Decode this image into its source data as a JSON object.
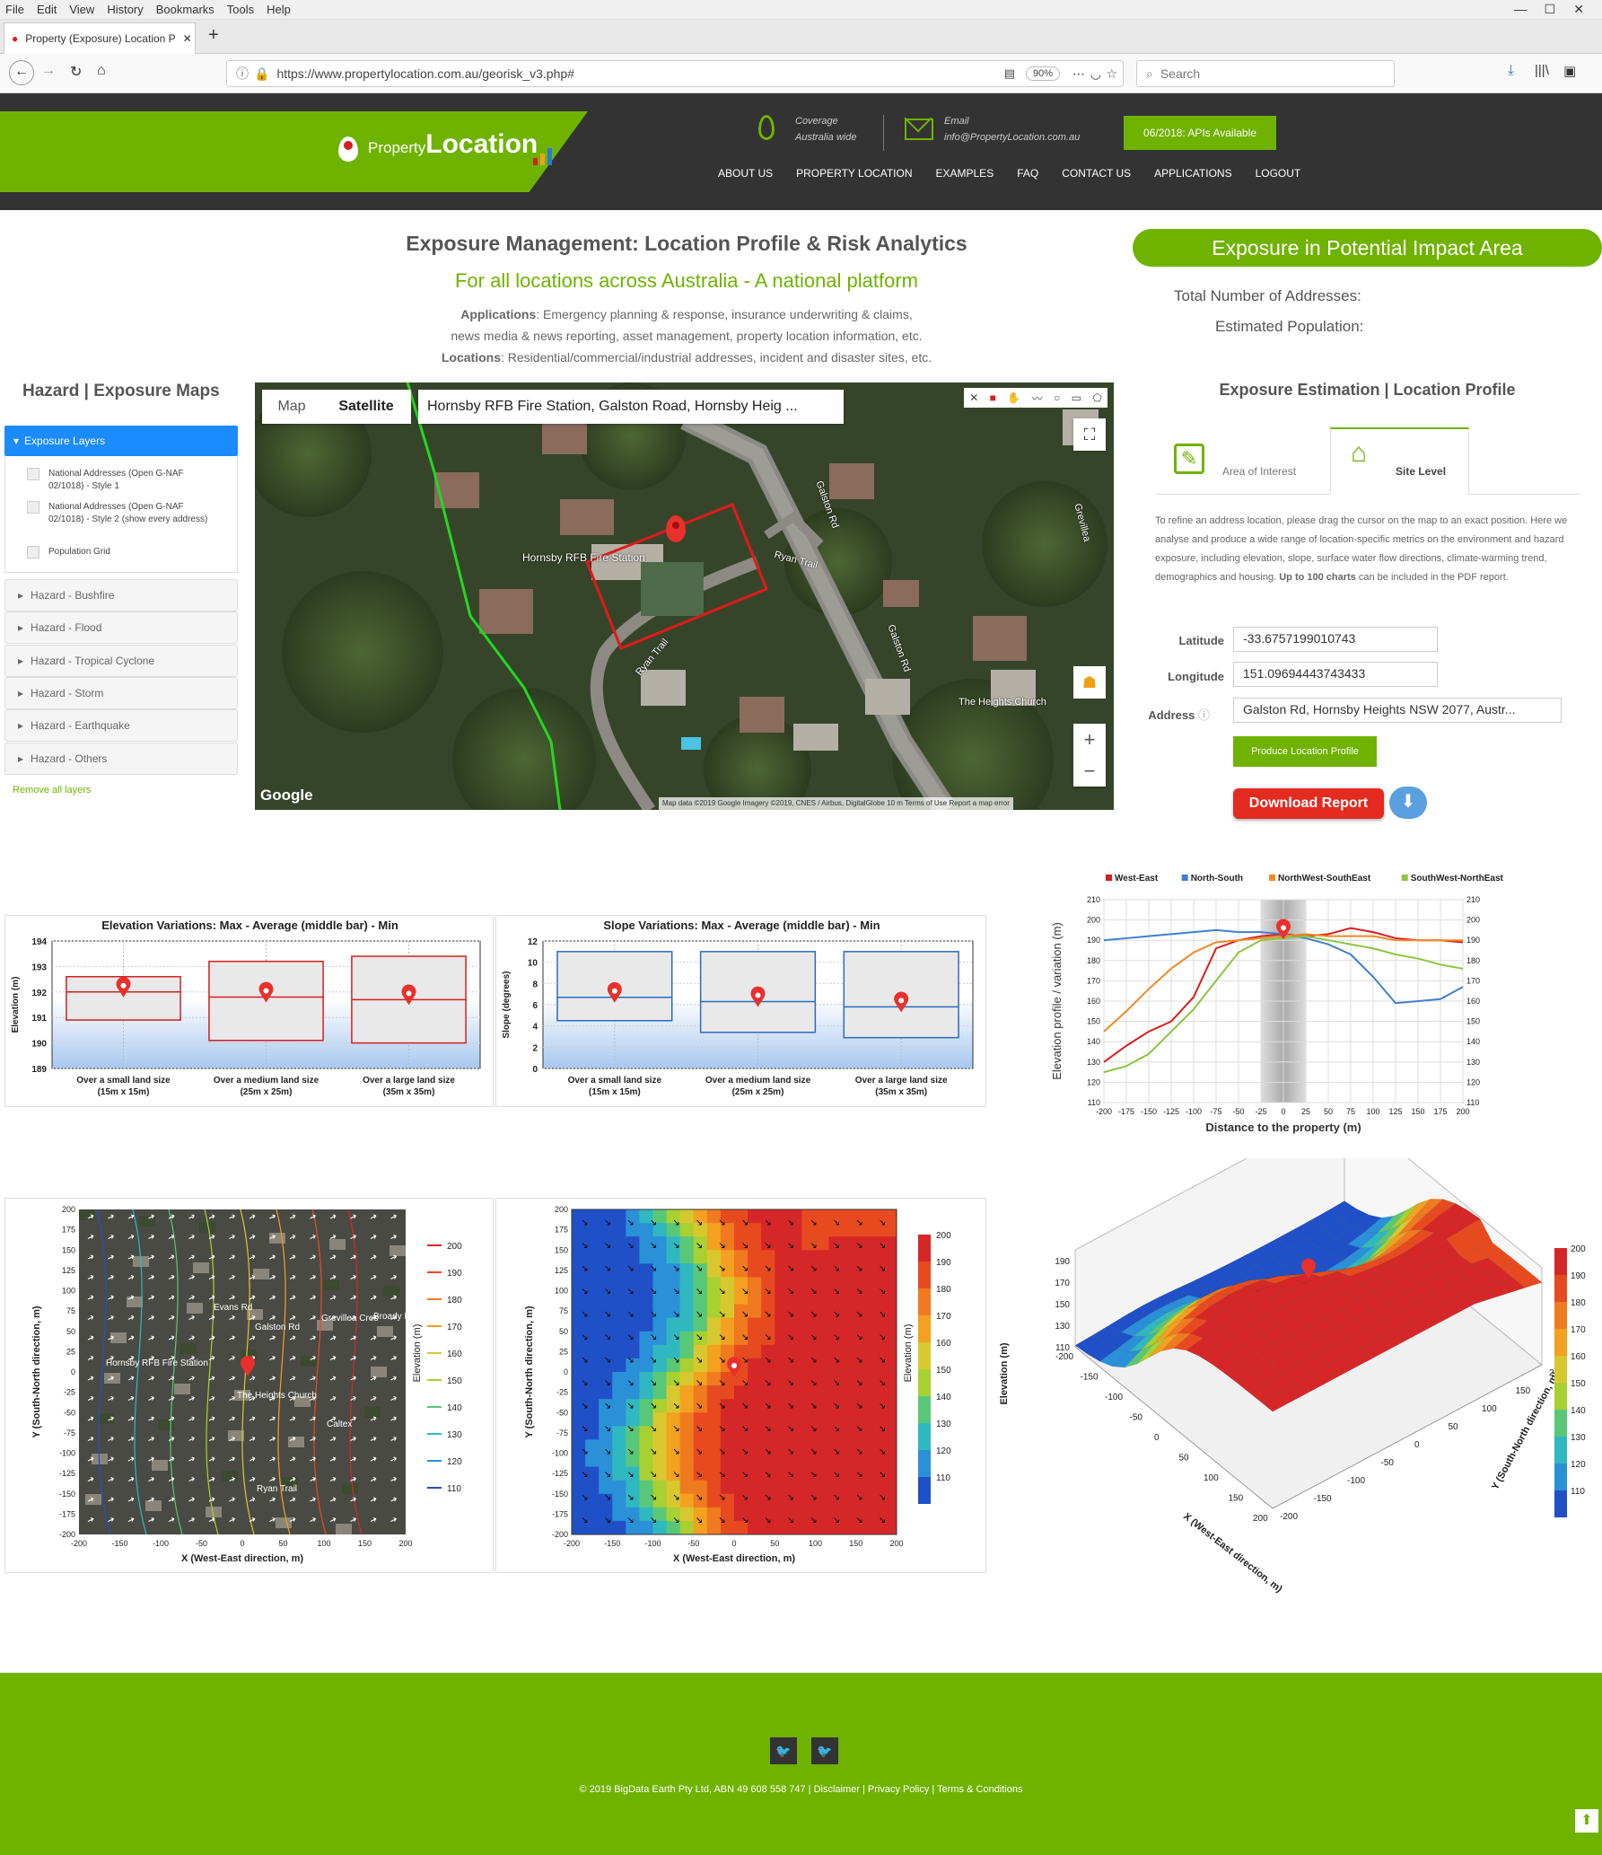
{
  "browser": {
    "menu": [
      "File",
      "Edit",
      "View",
      "History",
      "Bookmarks",
      "Tools",
      "Help"
    ],
    "tab_title": "Property (Exposure) Location P",
    "url": "https://www.propertylocation.com.au/georisk_v3.php#",
    "zoom": "90%",
    "search_placeholder": "Search"
  },
  "header": {
    "logo": "PropertyLocation",
    "coverage_label": "Coverage",
    "coverage_value": "Australia wide",
    "email_label": "Email",
    "email_value": "info@PropertyLocation.com.au",
    "api_button": "06/2018: APIs Available",
    "nav": [
      "ABOUT US",
      "PROPERTY LOCATION",
      "EXAMPLES",
      "FAQ",
      "CONTACT US",
      "APPLICATIONS",
      "LOGOUT"
    ]
  },
  "intro": {
    "title": "Exposure Management: Location Profile & Risk Analytics",
    "subtitle": "For all locations across Australia - A national platform",
    "apps_label": "Applications",
    "apps_text": ": Emergency planning & response, insurance underwriting & claims,",
    "apps_text2": "news media & news reporting, asset management, property location information, etc.",
    "loc_label": "Locations",
    "loc_text": ": Residential/commercial/industrial addresses, incident and disaster sites, etc."
  },
  "exposure": {
    "heading": "Exposure in Potential Impact Area",
    "total_label": "Total Number of Addresses:",
    "pop_label": "Estimated Population:"
  },
  "sidebar": {
    "title": "Hazard | Exposure Maps",
    "active_group": "Exposure Layers",
    "layers": [
      "National Addresses (Open G-NAF 02/1018) - Style 1",
      "National Addresses (Open G-NAF 02/1018) - Style 2 (show every address)",
      "Population Grid"
    ],
    "groups": [
      "Hazard - Bushfire",
      "Hazard - Flood",
      "Hazard - Tropical Cyclone",
      "Hazard - Storm",
      "Hazard - Earthquake",
      "Hazard - Others"
    ],
    "remove": "Remove all layers"
  },
  "map": {
    "tab_map": "Map",
    "tab_sat": "Satellite",
    "search_value": "Hornsby RFB Fire Station, Galston Road, Hornsby Heig ...",
    "labels": [
      "Hornsby RFB Fire Station",
      "Ryan Trail",
      "Galston Rd",
      "The Heights Church",
      "Ryan Trail",
      "Galston Rd",
      "Grevillea"
    ],
    "google": "Google",
    "attribution": "Map data ©2019 Google Imagery ©2019, CNES / Airbus, DigitalGlobe   10 m   Terms of Use   Report a map error"
  },
  "profile": {
    "heading": "Exposure Estimation | Location Profile",
    "tab_aoi": "Area of Interest",
    "tab_site": "Site Level",
    "desc": "To refine an address location, please drag the cursor on the map to an exact position. Here we analyse and produce a wide range of location-specific metrics on the environment and hazard exposure, including elevation, slope, surface water flow directions, climate-warming trend, demographics and housing.",
    "desc_bold": "Up to 100 charts",
    "desc_end": "can be included in the PDF report.",
    "lat_label": "Latitude",
    "lat_value": "-33.6757199010743",
    "lon_label": "Longitude",
    "lon_value": "151.09694443743433",
    "addr_label": "Address",
    "addr_value": "Galston Rd, Hornsby Heights NSW 2077, Austr...",
    "produce_btn": "Produce Location Profile",
    "download_btn": "Download Report"
  },
  "chart_data": [
    {
      "type": "bar",
      "title": "Elevation Variations: Max - Average (middle bar) - Min",
      "ylabel": "Elevation (m)",
      "ylim": [
        189,
        194
      ],
      "yticks": [
        "194",
        "193",
        "192",
        "191",
        "190",
        "189"
      ],
      "categories": [
        "Over a small land size (15m x 15m)",
        "Over a medium land size (25m x 25m)",
        "Over a large land size (35m x 35m)"
      ],
      "cat_line1": [
        "Over a small land size",
        "Over a medium land size",
        "Over a large land size"
      ],
      "cat_line2": [
        "(15m x 15m)",
        "(25m x 25m)",
        "(35m x 35m)"
      ],
      "max": [
        192.6,
        193.2,
        193.4
      ],
      "avg": [
        192.0,
        191.8,
        191.7
      ],
      "min": [
        190.9,
        190.1,
        190.0
      ],
      "color": "#d32020"
    },
    {
      "type": "bar",
      "title": "Slope Variations: Max - Average (middle bar) - Min",
      "ylabel": "Slope (degrees)",
      "ylim": [
        0,
        12
      ],
      "yticks": [
        "12",
        "10",
        "8",
        "6",
        "4",
        "2",
        "0"
      ],
      "categories": [
        "Over a small land size (15m x 15m)",
        "Over a medium land size (25m x 25m)",
        "Over a large land size (35m x 35m)"
      ],
      "cat_line1": [
        "Over a small land size",
        "Over a medium land size",
        "Over a large land size"
      ],
      "cat_line2": [
        "(15m x 15m)",
        "(25m x 25m)",
        "(35m x 35m)"
      ],
      "max": [
        11.0,
        11.0,
        11.0
      ],
      "avg": [
        6.7,
        6.3,
        5.8
      ],
      "min": [
        4.5,
        3.4,
        2.9
      ],
      "color": "#2a6bbf"
    },
    {
      "type": "line",
      "xlabel": "Distance to the property (m)",
      "ylabel": "Elevation profile / variation (m)",
      "xlim": [
        -200,
        200
      ],
      "ylim": [
        110,
        210
      ],
      "xticks": [
        "-200",
        "-175",
        "-150",
        "-125",
        "-100",
        "-75",
        "-50",
        "-25",
        "0",
        "25",
        "50",
        "75",
        "100",
        "125",
        "150",
        "175",
        "200"
      ],
      "yticks": [
        "210",
        "200",
        "190",
        "180",
        "170",
        "160",
        "150",
        "140",
        "130",
        "120",
        "110"
      ],
      "x": [
        -200,
        -175,
        -150,
        -125,
        -100,
        -75,
        -50,
        -25,
        0,
        25,
        50,
        75,
        100,
        125,
        150,
        175,
        200
      ],
      "series": [
        {
          "name": "West-East",
          "color": "#d81e1e",
          "values": [
            130,
            138,
            145,
            150,
            162,
            186,
            190,
            192,
            193,
            192,
            193,
            196,
            194,
            191,
            190,
            190,
            189
          ]
        },
        {
          "name": "North-South",
          "color": "#3f7fd0",
          "values": [
            190,
            191,
            192,
            193,
            194,
            195,
            194,
            194,
            193,
            191,
            188,
            183,
            172,
            159,
            160,
            161,
            167
          ]
        },
        {
          "name": "NorthWest-SouthEast",
          "color": "#f08a24",
          "values": [
            145,
            155,
            166,
            176,
            184,
            189,
            190,
            191,
            192,
            193,
            192,
            192,
            192,
            190,
            190,
            190,
            190
          ]
        },
        {
          "name": "SouthWest-NorthEast",
          "color": "#8cc63f",
          "values": [
            125,
            128,
            134,
            145,
            156,
            170,
            184,
            190,
            191,
            192,
            190,
            188,
            186,
            183,
            181,
            178,
            176
          ]
        }
      ]
    },
    {
      "type": "heatmap",
      "title": "",
      "xlabel": "X (West-East direction, m)",
      "ylabel": "Y (South-North direction, m)",
      "xticks": [
        "-200",
        "-150",
        "-100",
        "-50",
        "0",
        "50",
        "100",
        "150",
        "200"
      ],
      "yticks": [
        "200",
        "175",
        "150",
        "125",
        "100",
        "75",
        "50",
        "25",
        "0",
        "-25",
        "-50",
        "-75",
        "-100",
        "-125",
        "-150",
        "-175",
        "-200"
      ],
      "legend_title": "Elevation (m)",
      "legend_values": [
        "200",
        "190",
        "180",
        "170",
        "160",
        "150",
        "140",
        "130",
        "120",
        "110"
      ],
      "legend_colors": [
        "#d62728",
        "#e84a20",
        "#f07a20",
        "#f4a020",
        "#d8c830",
        "#a8d030",
        "#58c878",
        "#30b8c0",
        "#2a90d8",
        "#2050c8"
      ],
      "labels": [
        "Evans Rd",
        "Broady Repairs",
        "Hornsby RFB Fire Station",
        "The Heights Church",
        "Caltex",
        "Galston Rd",
        "Grevillea Cres",
        "Ryan Trail"
      ]
    },
    {
      "type": "heatmap",
      "title": "",
      "xlabel": "X (West-East direction, m)",
      "ylabel": "Y (South-North direction, m)",
      "xticks": [
        "-200",
        "-150",
        "-100",
        "-50",
        "0",
        "50",
        "100",
        "150",
        "200"
      ],
      "yticks": [
        "200",
        "175",
        "150",
        "125",
        "100",
        "75",
        "50",
        "25",
        "0",
        "-25",
        "-50",
        "-75",
        "-100",
        "-125",
        "-150",
        "-175",
        "-200"
      ],
      "legend_title": "Elevation (m)",
      "legend_values": [
        "200",
        "190",
        "180",
        "170",
        "160",
        "150",
        "140",
        "130",
        "120",
        "110"
      ]
    },
    {
      "type": "heatmap",
      "title": "",
      "xlabel": "X (West-East direction, m)",
      "ylabel": "Y (South-North direction, m)",
      "zlabel": "Elevation (m)",
      "xticks": [
        "-200",
        "-150",
        "-100",
        "-50",
        "0",
        "50",
        "100",
        "150",
        "200"
      ],
      "yticks": [
        "-200",
        "-150",
        "-100",
        "-50",
        "0",
        "50",
        "100",
        "150",
        "200"
      ],
      "zticks": [
        "190",
        "170",
        "150",
        "130",
        "110"
      ],
      "legend_values": [
        "200",
        "190",
        "180",
        "170",
        "160",
        "150",
        "140",
        "130",
        "120",
        "110"
      ]
    }
  ],
  "footer": {
    "copyright": "© 2019 BigData Earth Pty Ltd, ABN 49 608 558 747 | Disclaimer | Privacy Policy | Terms & Conditions"
  }
}
